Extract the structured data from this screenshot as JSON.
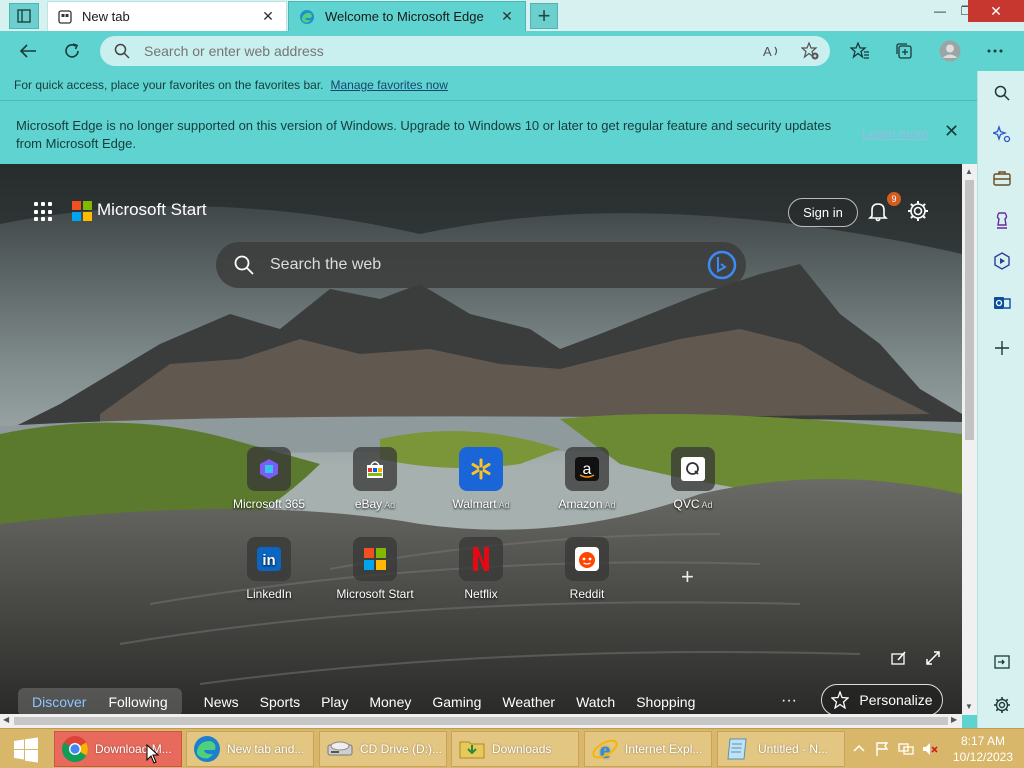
{
  "browser": {
    "tabs": [
      {
        "title": "New tab",
        "icon": "newtab-icon",
        "active": true
      },
      {
        "title": "Welcome to Microsoft Edge",
        "icon": "edge-icon",
        "active": false
      }
    ],
    "address_placeholder": "Search or enter web address"
  },
  "favbar": {
    "text": "For quick access, place your favorites on the favorites bar.",
    "link": "Manage favorites now"
  },
  "infobar": {
    "message": "Microsoft Edge is no longer supported on this version of Windows. Upgrade to Windows 10 or later to get regular feature and security updates from Microsoft Edge.",
    "learn_more": "Learn more"
  },
  "start": {
    "brand": "Microsoft Start",
    "signin": "Sign in",
    "notifications": "9",
    "search_placeholder": "Search the web",
    "tiles": [
      {
        "label": "Microsoft 365",
        "ad": ""
      },
      {
        "label": "eBay",
        "ad": "Ad"
      },
      {
        "label": "Walmart",
        "ad": "Ad"
      },
      {
        "label": "Amazon",
        "ad": "Ad"
      },
      {
        "label": "QVC",
        "ad": "Ad"
      },
      {
        "label": "LinkedIn",
        "ad": ""
      },
      {
        "label": "Microsoft Start",
        "ad": ""
      },
      {
        "label": "Netflix",
        "ad": ""
      },
      {
        "label": "Reddit",
        "ad": ""
      }
    ],
    "feed_tabs": [
      "Discover",
      "Following",
      "News",
      "Sports",
      "Play",
      "Money",
      "Gaming",
      "Weather",
      "Watch",
      "Shopping"
    ],
    "feed_more": "···",
    "personalize": "Personalize"
  },
  "taskbar": {
    "items": [
      {
        "label": "Download M...",
        "icon": "chrome-icon"
      },
      {
        "label": "New tab and...",
        "icon": "edge-icon"
      },
      {
        "label": "CD Drive (D:)...",
        "icon": "cd-drive-icon"
      },
      {
        "label": "Downloads",
        "icon": "folder-icon"
      },
      {
        "label": "Internet Expl...",
        "icon": "ie-icon"
      },
      {
        "label": "Untitled - N...",
        "icon": "notepad-icon"
      }
    ],
    "time": "8:17 AM",
    "date": "10/12/2023"
  },
  "colors": {
    "accent": "#5fd3d0",
    "taskbar": "#d8b66a",
    "active_task": "#e86a5c"
  }
}
